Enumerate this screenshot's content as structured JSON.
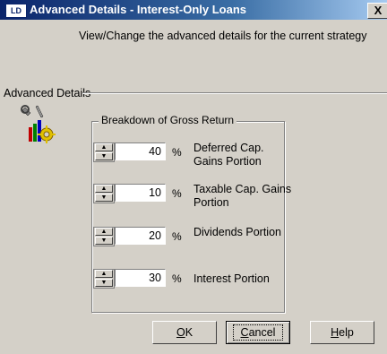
{
  "window": {
    "icon_text": "LD",
    "title": "Advanced Details - Interest-Only Loans",
    "close_label": "X"
  },
  "description": "View/Change the advanced details for the current strategy",
  "section": {
    "label": "Advanced Details",
    "icon": "tools-icon"
  },
  "group": {
    "title": "Breakdown of Gross Return",
    "rows": [
      {
        "value": "40",
        "unit": "%",
        "label": "Deferred Cap. Gains Portion"
      },
      {
        "value": "10",
        "unit": "%",
        "label": "Taxable Cap. Gains Portion"
      },
      {
        "value": "20",
        "unit": "%",
        "label": "Dividends Portion"
      },
      {
        "value": "30",
        "unit": "%",
        "label": "Interest Portion"
      }
    ]
  },
  "buttons": {
    "ok": {
      "accel": "O",
      "rest": "K"
    },
    "cancel": {
      "accel": "C",
      "rest": "ancel"
    },
    "help": {
      "accel": "H",
      "rest": "elp"
    }
  }
}
